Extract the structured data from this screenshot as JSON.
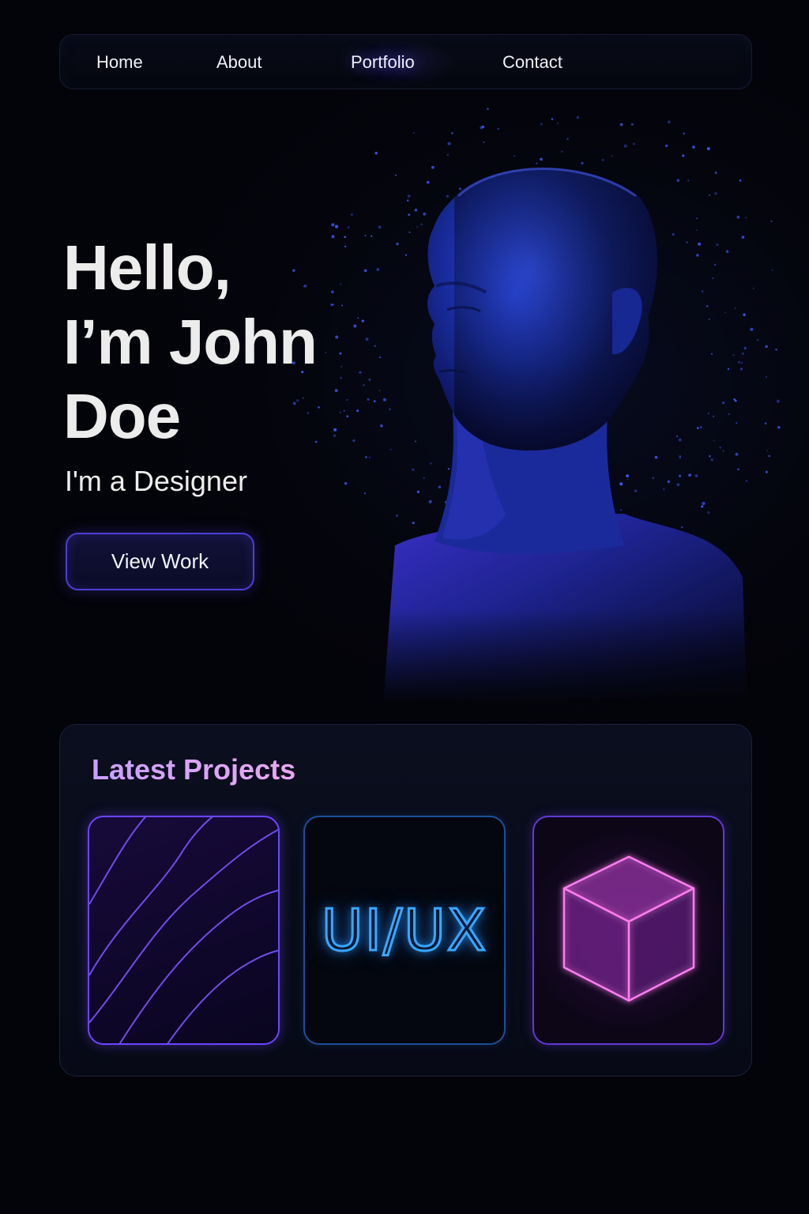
{
  "nav": {
    "items": [
      {
        "label": "Home"
      },
      {
        "label": "About"
      },
      {
        "label": "Portfolio"
      },
      {
        "label": "Contact"
      }
    ]
  },
  "hero": {
    "title_lines": [
      "Hello,",
      "I’m John",
      "Doe"
    ],
    "subtitle": "I'm a Designer",
    "cta_label": "View Work"
  },
  "projects": {
    "title": "Latest Projects",
    "cards": [
      {
        "icon": "wave-lines-icon"
      },
      {
        "text": "UI/UX"
      },
      {
        "icon": "cube-icon"
      }
    ]
  },
  "colors": {
    "background": "#030409",
    "accent_purple": "#6c45ff",
    "accent_blue": "#39a7ff",
    "accent_pink": "#e06ae8",
    "heading_text": "#ececec"
  }
}
